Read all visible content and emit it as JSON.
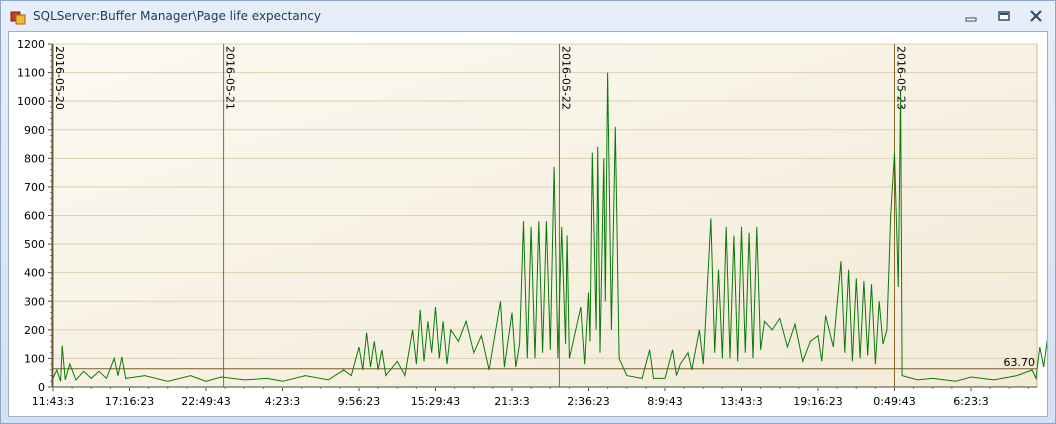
{
  "window": {
    "title": "SQLServer:Buffer Manager\\Page life expectancy",
    "icons": [
      "app-icon",
      "minimize-icon",
      "restore-icon",
      "close-icon"
    ]
  },
  "chart_data": {
    "type": "line",
    "title": "",
    "xlabel": "",
    "ylabel": "",
    "ylim": [
      0,
      1200
    ],
    "yticks": [
      0,
      100,
      200,
      300,
      400,
      500,
      600,
      700,
      800,
      900,
      1000,
      1100,
      1200
    ],
    "xticks": [
      "11:43:3",
      "17:16:23",
      "22:49:43",
      "4:23:3",
      "9:56:23",
      "15:29:43",
      "21:3:3",
      "2:36:23",
      "8:9:43",
      "13:43:3",
      "19:16:23",
      "0:49:43",
      "6:23:3"
    ],
    "date_markers": [
      {
        "label": "2016-05-20",
        "at_tick": 0
      },
      {
        "label": "2016-05-21",
        "at_tick": 2.23
      },
      {
        "label": "2016-05-22",
        "at_tick": 6.62
      },
      {
        "label": "2016-05-23",
        "at_tick": 11.0
      }
    ],
    "reference_line": {
      "value": 63.7,
      "label": "63.70"
    },
    "series": [
      {
        "color": "#0a7a0a",
        "points": [
          [
            0,
            30
          ],
          [
            0.05,
            60
          ],
          [
            0.1,
            20
          ],
          [
            0.12,
            145
          ],
          [
            0.16,
            25
          ],
          [
            0.22,
            80
          ],
          [
            0.3,
            25
          ],
          [
            0.4,
            55
          ],
          [
            0.5,
            30
          ],
          [
            0.6,
            55
          ],
          [
            0.7,
            30
          ],
          [
            0.8,
            100
          ],
          [
            0.85,
            40
          ],
          [
            0.9,
            105
          ],
          [
            0.95,
            30
          ],
          [
            1.2,
            40
          ],
          [
            1.5,
            20
          ],
          [
            1.8,
            40
          ],
          [
            2.0,
            20
          ],
          [
            2.2,
            35
          ],
          [
            2.5,
            25
          ],
          [
            2.8,
            30
          ],
          [
            3.0,
            20
          ],
          [
            3.3,
            40
          ],
          [
            3.6,
            25
          ],
          [
            3.8,
            60
          ],
          [
            3.9,
            40
          ],
          [
            4.0,
            140
          ],
          [
            4.05,
            60
          ],
          [
            4.1,
            190
          ],
          [
            4.15,
            70
          ],
          [
            4.2,
            160
          ],
          [
            4.25,
            60
          ],
          [
            4.3,
            130
          ],
          [
            4.35,
            40
          ],
          [
            4.5,
            90
          ],
          [
            4.6,
            40
          ],
          [
            4.7,
            200
          ],
          [
            4.75,
            80
          ],
          [
            4.8,
            270
          ],
          [
            4.85,
            90
          ],
          [
            4.9,
            230
          ],
          [
            4.95,
            120
          ],
          [
            5.0,
            280
          ],
          [
            5.05,
            100
          ],
          [
            5.1,
            230
          ],
          [
            5.15,
            80
          ],
          [
            5.2,
            200
          ],
          [
            5.3,
            160
          ],
          [
            5.4,
            230
          ],
          [
            5.5,
            120
          ],
          [
            5.6,
            180
          ],
          [
            5.7,
            60
          ],
          [
            5.85,
            300
          ],
          [
            5.9,
            70
          ],
          [
            6.0,
            260
          ],
          [
            6.05,
            70
          ],
          [
            6.1,
            150
          ],
          [
            6.15,
            580
          ],
          [
            6.2,
            100
          ],
          [
            6.25,
            560
          ],
          [
            6.3,
            100
          ],
          [
            6.35,
            580
          ],
          [
            6.4,
            120
          ],
          [
            6.45,
            580
          ],
          [
            6.5,
            130
          ],
          [
            6.55,
            770
          ],
          [
            6.6,
            100
          ],
          [
            6.65,
            560
          ],
          [
            6.7,
            150
          ],
          [
            6.72,
            530
          ],
          [
            6.75,
            100
          ],
          [
            6.9,
            280
          ],
          [
            6.95,
            80
          ],
          [
            7.0,
            330
          ],
          [
            7.02,
            160
          ],
          [
            7.05,
            820
          ],
          [
            7.1,
            200
          ],
          [
            7.12,
            840
          ],
          [
            7.15,
            120
          ],
          [
            7.2,
            800
          ],
          [
            7.22,
            300
          ],
          [
            7.25,
            1100
          ],
          [
            7.3,
            200
          ],
          [
            7.35,
            910
          ],
          [
            7.4,
            100
          ],
          [
            7.5,
            40
          ],
          [
            7.7,
            30
          ],
          [
            7.8,
            130
          ],
          [
            7.85,
            30
          ],
          [
            8.0,
            30
          ],
          [
            8.05,
            80
          ],
          [
            8.1,
            130
          ],
          [
            8.15,
            40
          ],
          [
            8.2,
            80
          ],
          [
            8.3,
            120
          ],
          [
            8.35,
            60
          ],
          [
            8.45,
            200
          ],
          [
            8.5,
            80
          ],
          [
            8.6,
            590
          ],
          [
            8.65,
            120
          ],
          [
            8.7,
            410
          ],
          [
            8.75,
            100
          ],
          [
            8.8,
            560
          ],
          [
            8.85,
            100
          ],
          [
            8.9,
            530
          ],
          [
            8.95,
            90
          ],
          [
            9.0,
            560
          ],
          [
            9.05,
            120
          ],
          [
            9.1,
            540
          ],
          [
            9.15,
            100
          ],
          [
            9.2,
            560
          ],
          [
            9.25,
            130
          ],
          [
            9.3,
            230
          ],
          [
            9.4,
            200
          ],
          [
            9.5,
            240
          ],
          [
            9.6,
            140
          ],
          [
            9.7,
            220
          ],
          [
            9.8,
            90
          ],
          [
            9.9,
            160
          ],
          [
            10.0,
            180
          ],
          [
            10.05,
            90
          ],
          [
            10.1,
            250
          ],
          [
            10.2,
            140
          ],
          [
            10.3,
            440
          ],
          [
            10.35,
            120
          ],
          [
            10.4,
            410
          ],
          [
            10.45,
            90
          ],
          [
            10.5,
            380
          ],
          [
            10.55,
            100
          ],
          [
            10.6,
            370
          ],
          [
            10.65,
            110
          ],
          [
            10.7,
            360
          ],
          [
            10.75,
            80
          ],
          [
            10.8,
            300
          ],
          [
            10.85,
            150
          ],
          [
            10.9,
            200
          ],
          [
            10.95,
            600
          ],
          [
            11.0,
            820
          ],
          [
            11.05,
            350
          ],
          [
            11.08,
            1040
          ],
          [
            11.1,
            40
          ],
          [
            11.3,
            25
          ],
          [
            11.5,
            30
          ],
          [
            11.8,
            20
          ],
          [
            12.0,
            35
          ],
          [
            12.3,
            25
          ],
          [
            12.6,
            40
          ],
          [
            12.8,
            60
          ],
          [
            12.85,
            30
          ],
          [
            12.9,
            140
          ],
          [
            12.95,
            70
          ],
          [
            13.0,
            170
          ],
          [
            13.02,
            80
          ]
        ]
      }
    ]
  }
}
